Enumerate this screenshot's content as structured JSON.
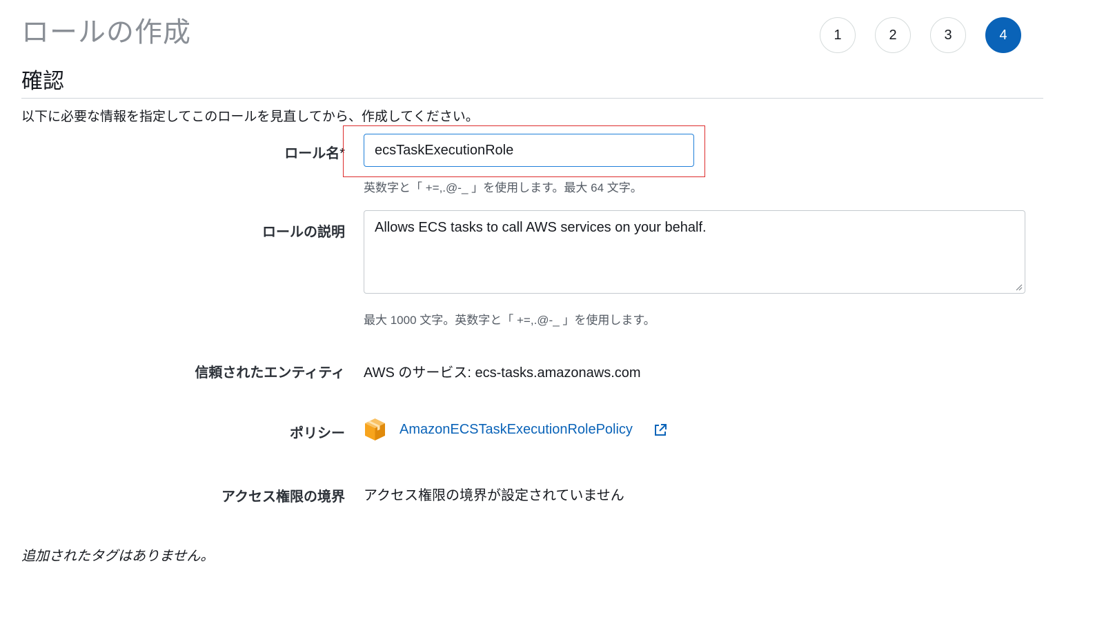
{
  "page": {
    "title": "ロールの作成"
  },
  "steps": [
    {
      "label": "1",
      "active": false
    },
    {
      "label": "2",
      "active": false
    },
    {
      "label": "3",
      "active": false
    },
    {
      "label": "4",
      "active": true
    }
  ],
  "review": {
    "section_title": "確認",
    "intro": "以下に必要な情報を指定してこのロールを見直してから、作成してください。"
  },
  "role_name": {
    "label": "ロール名",
    "required_mark": "*",
    "value": "ecsTaskExecutionRole",
    "hint": "英数字と「 +=,.@-_ 」を使用します。最大 64 文字。"
  },
  "role_description": {
    "label": "ロールの説明",
    "value": "Allows ECS tasks to call AWS services on your behalf.",
    "hint": "最大 1000 文字。英数字と「 +=,.@-_ 」を使用します。"
  },
  "trusted_entity": {
    "label": "信頼されたエンティティ",
    "value": "AWS のサービス: ecs-tasks.amazonaws.com"
  },
  "policies": {
    "label": "ポリシー",
    "items": [
      {
        "name": "AmazonECSTaskExecutionRolePolicy",
        "icon": "aws-box-icon"
      }
    ]
  },
  "permissions_boundary": {
    "label": "アクセス権限の境界",
    "value": "アクセス権限の境界が設定されていません"
  },
  "tags": {
    "empty_text": "追加されたタグはありません。"
  },
  "colors": {
    "accent": "#0a63b8",
    "highlight_border": "#dd2b2b",
    "input_focus": "#1f7fd9",
    "policy_icon": "#f7a41d"
  }
}
